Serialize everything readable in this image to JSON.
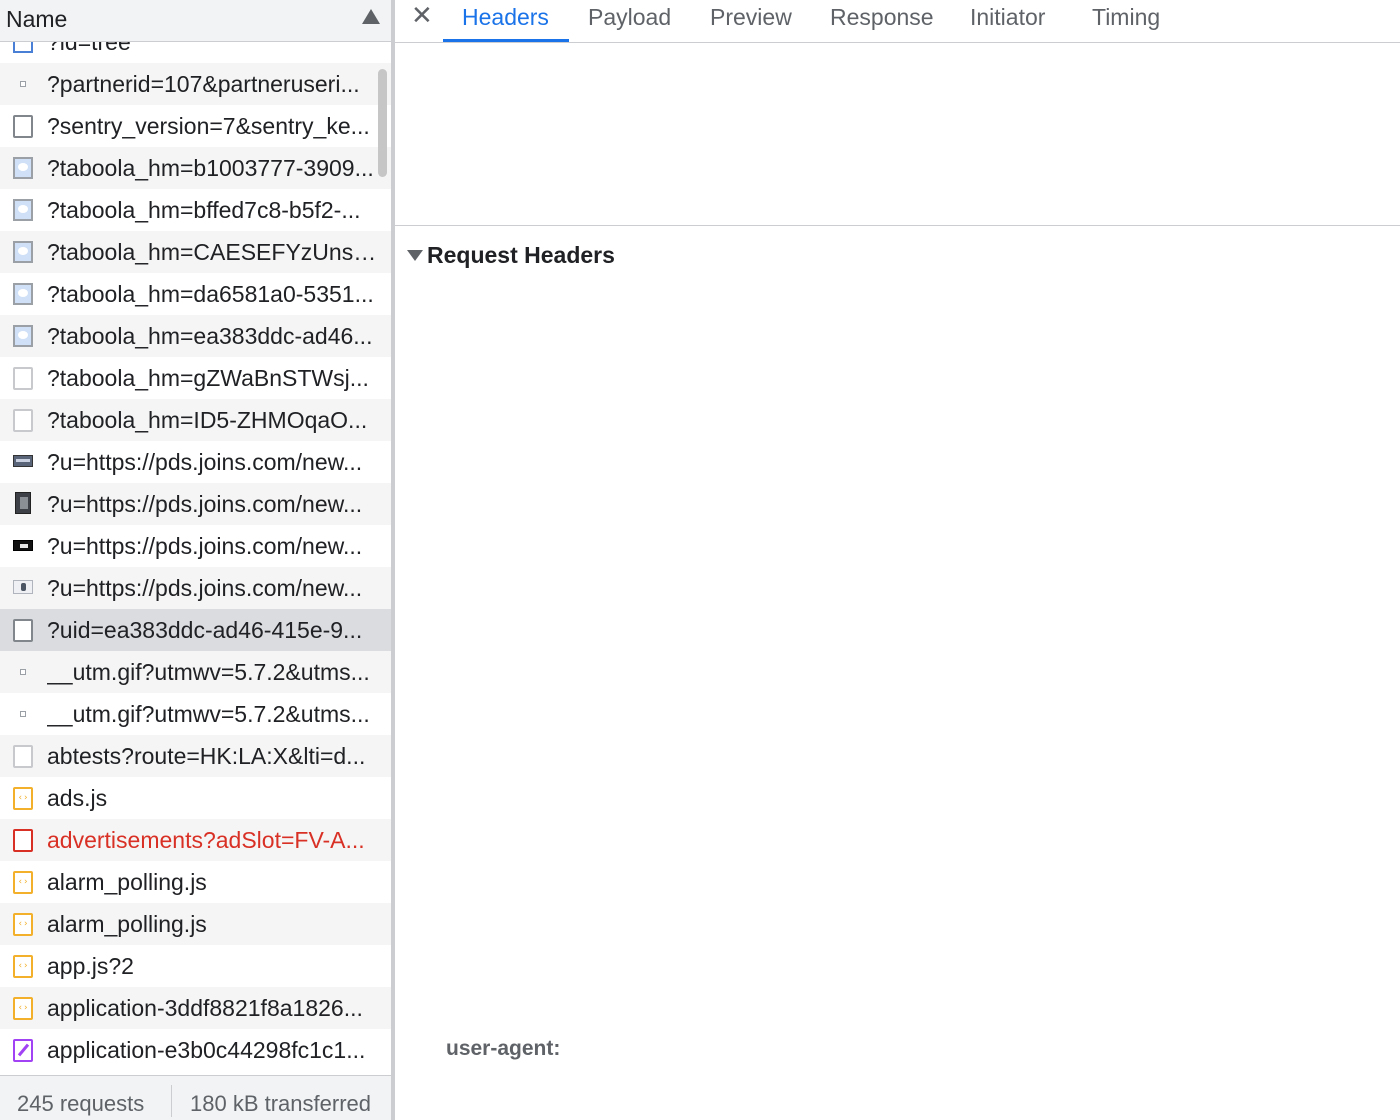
{
  "left_panel": {
    "header": {
      "name_label": "Name",
      "sort_icon": "triangle-up-icon"
    },
    "rows": [
      {
        "text": "?id=tree",
        "icon": "image-icon",
        "style": "normal"
      },
      {
        "text": "?partnerid=107&partneruseri...",
        "icon": "pixel-icon",
        "style": "normal"
      },
      {
        "text": "?sentry_version=7&sentry_ke...",
        "icon": "document-icon",
        "style": "normal"
      },
      {
        "text": "?taboola_hm=b1003777-3909...",
        "icon": "image-icon",
        "style": "normal"
      },
      {
        "text": "?taboola_hm=bffed7c8-b5f2-...",
        "icon": "image-icon",
        "style": "normal"
      },
      {
        "text": "?taboola_hm=CAESEFYzUnsa...",
        "icon": "image-icon",
        "style": "normal"
      },
      {
        "text": "?taboola_hm=da6581a0-5351...",
        "icon": "image-icon",
        "style": "normal"
      },
      {
        "text": "?taboola_hm=ea383ddc-ad46...",
        "icon": "image-icon",
        "style": "normal"
      },
      {
        "text": "?taboola_hm=gZWaBnSTWsj...",
        "icon": "document-icon",
        "style": "normal"
      },
      {
        "text": "?taboola_hm=ID5-ZHMOqaO...",
        "icon": "document-icon",
        "style": "normal"
      },
      {
        "text": "?u=https://pds.joins.com/new...",
        "icon": "thumbnail-icon",
        "style": "normal"
      },
      {
        "text": "?u=https://pds.joins.com/new...",
        "icon": "thumbnail-icon",
        "style": "normal"
      },
      {
        "text": "?u=https://pds.joins.com/new...",
        "icon": "thumbnail-icon",
        "style": "normal"
      },
      {
        "text": "?u=https://pds.joins.com/new...",
        "icon": "thumbnail-icon",
        "style": "normal"
      },
      {
        "text": "?uid=ea383ddc-ad46-415e-9...",
        "icon": "document-icon",
        "style": "normal"
      },
      {
        "text": "__utm.gif?utmwv=5.7.2&utms...",
        "icon": "pixel-icon",
        "style": "normal"
      },
      {
        "text": "__utm.gif?utmwv=5.7.2&utms...",
        "icon": "pixel-icon",
        "style": "normal"
      },
      {
        "text": "abtests?route=HK:LA:X&lti=d...",
        "icon": "document-icon",
        "style": "normal"
      },
      {
        "text": "ads.js",
        "icon": "script-icon",
        "style": "normal"
      },
      {
        "text": "advertisements?adSlot=FV-A...",
        "icon": "error-document-icon",
        "style": "error"
      },
      {
        "text": "alarm_polling.js",
        "icon": "script-icon",
        "style": "normal"
      },
      {
        "text": "alarm_polling.js",
        "icon": "script-icon",
        "style": "normal"
      },
      {
        "text": "app.js?2",
        "icon": "script-icon",
        "style": "normal"
      },
      {
        "text": "application-3ddf8821f8a1826...",
        "icon": "script-icon",
        "style": "normal"
      },
      {
        "text": "application-e3b0c44298fc1c1...",
        "icon": "stylesheet-icon",
        "style": "normal"
      }
    ],
    "selected_row": 14,
    "status": {
      "requests": "245 requests",
      "transferred": "180 kB transferred"
    }
  },
  "right_panel": {
    "close_icon": "close-icon",
    "tabs": [
      {
        "label": "Headers",
        "active": true
      },
      {
        "label": "Payload",
        "active": false
      },
      {
        "label": "Preview",
        "active": false
      },
      {
        "label": "Response",
        "active": false
      },
      {
        "label": "Initiator",
        "active": false
      },
      {
        "label": "Timing",
        "active": false
      }
    ],
    "section": {
      "title": "Request Headers",
      "toggle_icon": "triangle-down-icon"
    },
    "header_name": "user-agent:"
  },
  "colors": {
    "accent": "#1a73e8",
    "error_text": "#d93025",
    "selected_row": "#dadce0",
    "zebra_row": "#f5f5f5",
    "script_icon": "#f2b02b",
    "stylesheet_icon": "#a142f4"
  }
}
